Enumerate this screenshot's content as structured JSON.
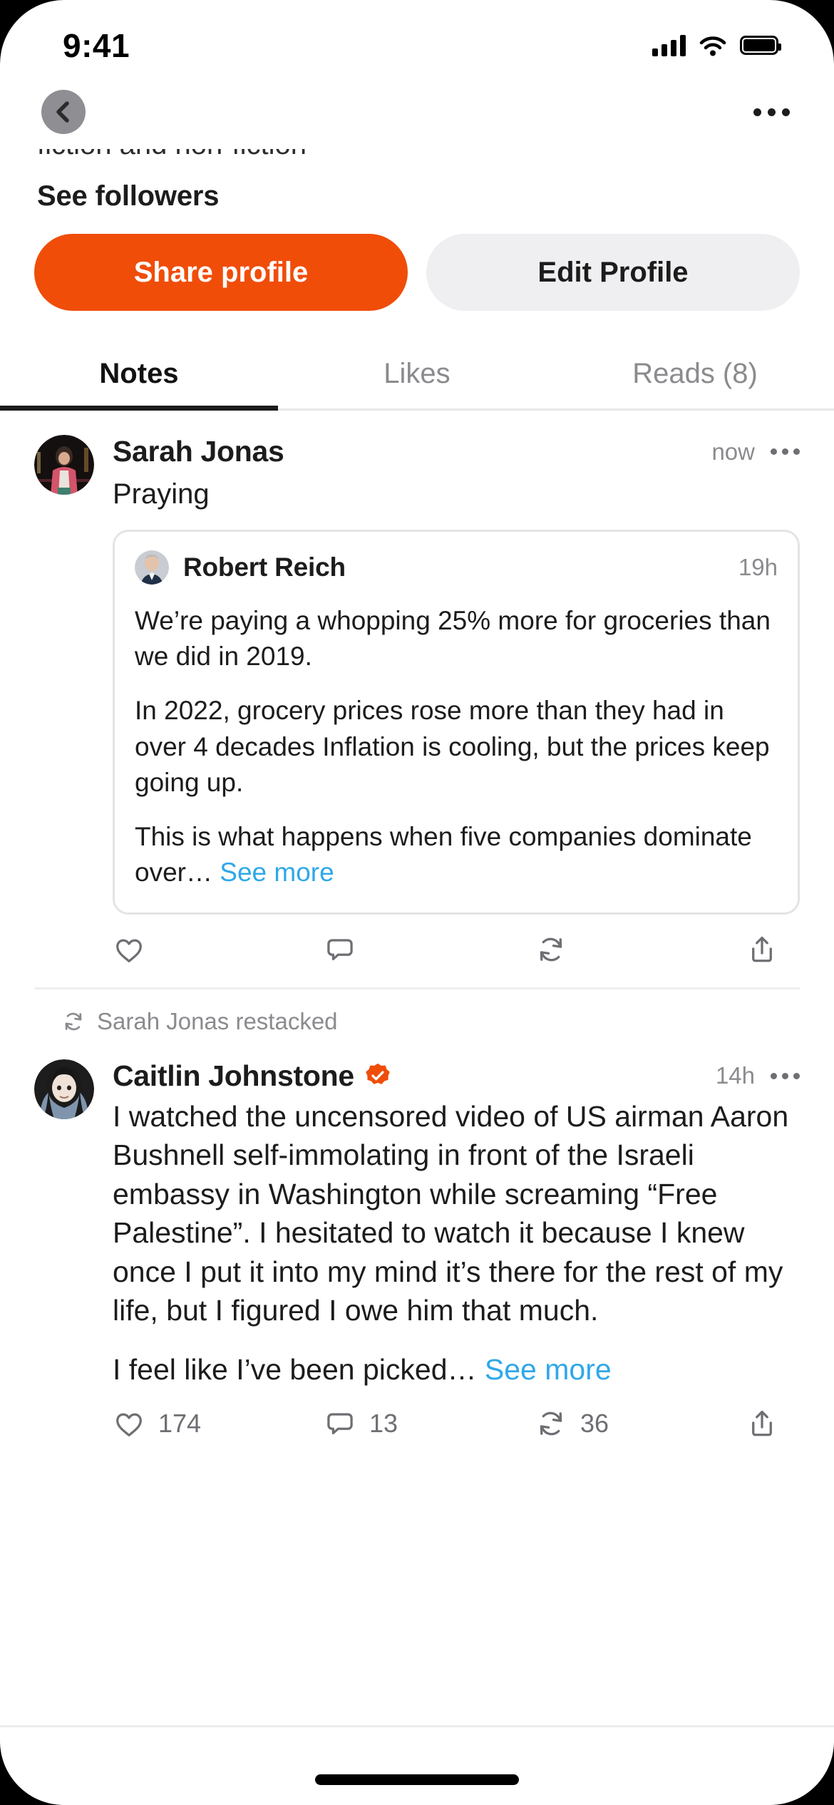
{
  "status_bar": {
    "time": "9:41",
    "signal_icon": "cellular-bars-icon",
    "wifi_icon": "wifi-icon",
    "battery_icon": "battery-full-icon"
  },
  "nav": {
    "back_icon": "chevron-left-icon",
    "more_icon": "more-horizontal-icon"
  },
  "profile": {
    "bio_clipped": "fiction and non-fiction",
    "followers_link": "See followers",
    "share_label": "Share profile",
    "edit_label": "Edit Profile",
    "accent_color": "#f04d09"
  },
  "tabs": [
    {
      "label": "Notes",
      "active": true
    },
    {
      "label": "Likes",
      "active": false
    },
    {
      "label": "Reads (8)",
      "active": false
    }
  ],
  "posts": [
    {
      "author": "Sarah Jonas",
      "time": "now",
      "text": "Praying",
      "quote": {
        "author": "Robert Reich",
        "time": "19h",
        "paragraphs": [
          "We’re paying a whopping 25% more for groceries than we did in 2019.",
          "In 2022, grocery prices rose more than they had in over 4 decades Inflation is cooling, but the prices keep going up.",
          "This is what happens when five companies dominate over… "
        ],
        "see_more": "See more"
      },
      "actions": {
        "like_count": "",
        "comment_count": "",
        "restack_count": "",
        "share_count": ""
      }
    },
    {
      "restack_label": "Sarah Jonas restacked",
      "author": "Caitlin Johnstone",
      "verified": true,
      "time": "14h",
      "paragraphs": [
        "I watched the uncensored video of US airman Aaron Bushnell self-immolating in front of the Israeli embassy in Washington while screaming “Free Palestine”. I hesitated to watch it because I knew once I put it into my mind it’s there for the rest of my life, but I figured I owe him that much.",
        "I feel like I’ve been picked… "
      ],
      "see_more": "See more",
      "actions": {
        "like_count": "174",
        "comment_count": "13",
        "restack_count": "36",
        "share_count": ""
      }
    }
  ],
  "icons": {
    "like": "heart-icon",
    "comment": "comment-bubble-icon",
    "restack": "restack-icon",
    "share": "share-icon",
    "verified": "verified-badge-icon"
  },
  "colors": {
    "link": "#2fa8e8",
    "muted": "#8b8b8f",
    "text": "#1c1c1c"
  }
}
